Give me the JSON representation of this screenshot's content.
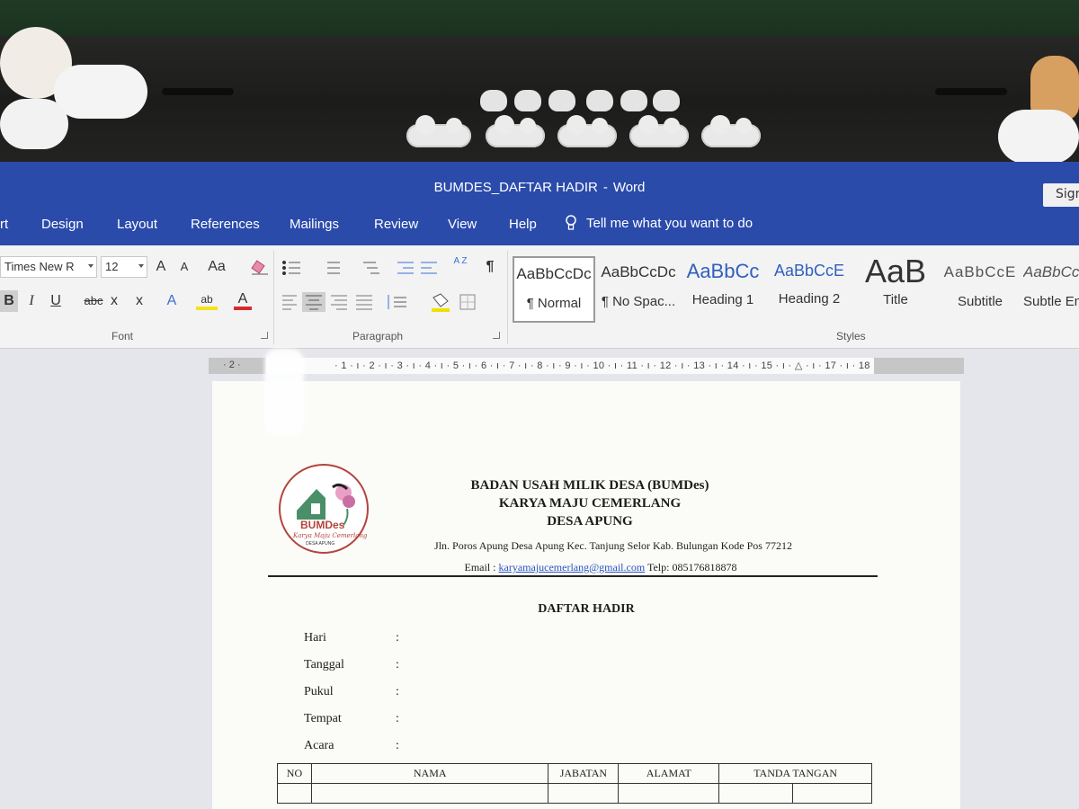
{
  "window": {
    "doc_name": "BUMDES_DAFTAR HADIR",
    "separator": "-",
    "app_name": "Word",
    "sign_in": "Sign"
  },
  "tabs": [
    "rt",
    "Design",
    "Layout",
    "References",
    "Mailings",
    "Review",
    "View",
    "Help"
  ],
  "tell_me": "Tell me what you want to do",
  "font": {
    "name": "Times New R",
    "size": "12",
    "group_label": "Font",
    "grow": "A",
    "shrink": "A",
    "case": "Aa",
    "bold": "B",
    "italic": "I",
    "underline": "U",
    "strike": "abc",
    "subscript": "x",
    "superscript": "x",
    "font_color": "A",
    "highlight": "ab"
  },
  "paragraph": {
    "group_label": "Paragraph",
    "sort": "A Z",
    "pilcrow": "¶"
  },
  "styles": {
    "group_label": "Styles",
    "items": [
      {
        "sample": "AaBbCcDc",
        "name": "¶ Normal",
        "selected": true
      },
      {
        "sample": "AaBbCcDc",
        "name": "¶ No Spac...",
        "selected": false
      },
      {
        "sample": "AaBbCc",
        "name": "Heading 1",
        "selected": false
      },
      {
        "sample": "AaBbCcE",
        "name": "Heading 2",
        "selected": false
      },
      {
        "sample": "AaB",
        "name": "Title",
        "selected": false
      },
      {
        "sample": "AaBbCcE",
        "name": "Subtitle",
        "selected": false
      },
      {
        "sample": "AaBbCc",
        "name": "Subtle Em",
        "selected": false
      }
    ]
  },
  "ruler": {
    "lead": "· 2 ·",
    "marks": "· 1 · ı · 2 · ı · 3 · ı · 4 · ı · 5 · ı · 6 · ı · 7 · ı · 8 · ı · 9 · ı · 10 · ı · 11 · ı · 12 · ı · 13 · ı · 14 · ı · 15 · ı · △ · ı · 17 · ı · 18"
  },
  "document": {
    "org_line1": "BADAN USAH MILIK DESA (BUMDes)",
    "org_line2": "KARYA MAJU CEMERLANG",
    "org_line3": "DESA APUNG",
    "address": "Jln. Poros Apung Desa Apung Kec. Tanjung Selor Kab. Bulungan Kode Pos 77212",
    "email_label": "Email :",
    "email": "karyamajucemerlang@gmail.com",
    "phone": "Telp: 085176818878",
    "logo_text": "BUMDes",
    "logo_script": "Karya Maju Cemerlang",
    "logo_small": "DESA APUNG",
    "heading": "DAFTAR HADIR",
    "fields": [
      "Hari",
      "Tanggal",
      "Pukul",
      "Tempat",
      "Acara"
    ],
    "colon": ":",
    "table_headers": [
      "NO",
      "NAMA",
      "JABATAN",
      "ALAMAT",
      "TANDA TANGAN"
    ]
  }
}
